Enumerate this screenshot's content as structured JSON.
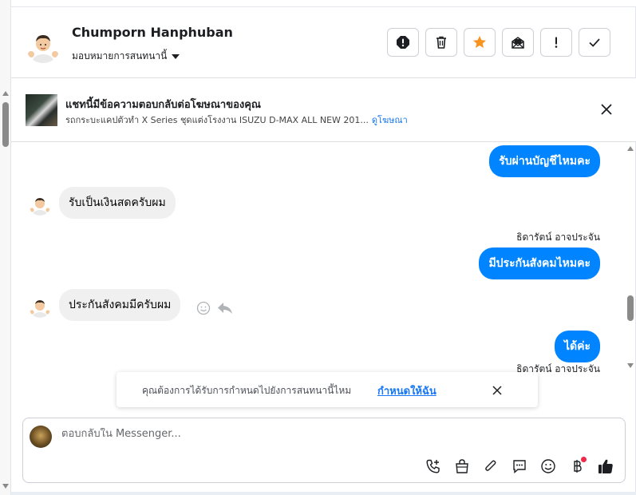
{
  "contact": {
    "name": "Chumporn Hanphuban",
    "assign_label": "มอบหมายการสนทนานี้"
  },
  "actions": [
    {
      "name": "report-spam",
      "icon": "alert-circle-icon"
    },
    {
      "name": "delete",
      "icon": "trash-icon"
    },
    {
      "name": "star",
      "icon": "star-icon"
    },
    {
      "name": "mark-unread",
      "icon": "envelope-icon"
    },
    {
      "name": "follow-up",
      "icon": "exclamation-icon"
    },
    {
      "name": "mark-done",
      "icon": "check-icon"
    }
  ],
  "ad_banner": {
    "title": "แชทนี้มีข้อความตอบกลับต่อโฆษณาของคุณ",
    "subtitle": "รถกระบะแคปตัวทำ X Series ชุดแต่งโรงงาน ISUZU D-MAX ALL NEW 201...",
    "link": "ดูโฆษณา"
  },
  "messages": [
    {
      "direction": "out",
      "text": "รับผ่านบัญชีไหมคะ",
      "sender": ""
    },
    {
      "direction": "in",
      "text": "รับเป็นเงินสดครับผม"
    },
    {
      "direction": "out",
      "text": "มีประกันสังคมไหมคะ",
      "sender": "ธิดารัตน์ อาจประจัน"
    },
    {
      "direction": "in",
      "text": "ประกันสังคมมีครับผม"
    },
    {
      "direction": "out",
      "text": "ได้ค่ะ",
      "sender": "ธิดารัตน์ อาจประจัน"
    }
  ],
  "prompt": {
    "text": "คุณต้องการได้รับการกำหนดไปยังการสนทนานี้ไหม",
    "link": "กำหนดให้ฉัน"
  },
  "composer": {
    "placeholder": "ตอบกลับใน Messenger..."
  },
  "colors": {
    "accent": "#0084ff",
    "star": "#f7931e",
    "incoming_bubble": "#f0f0f0",
    "notification": "#f02849"
  }
}
